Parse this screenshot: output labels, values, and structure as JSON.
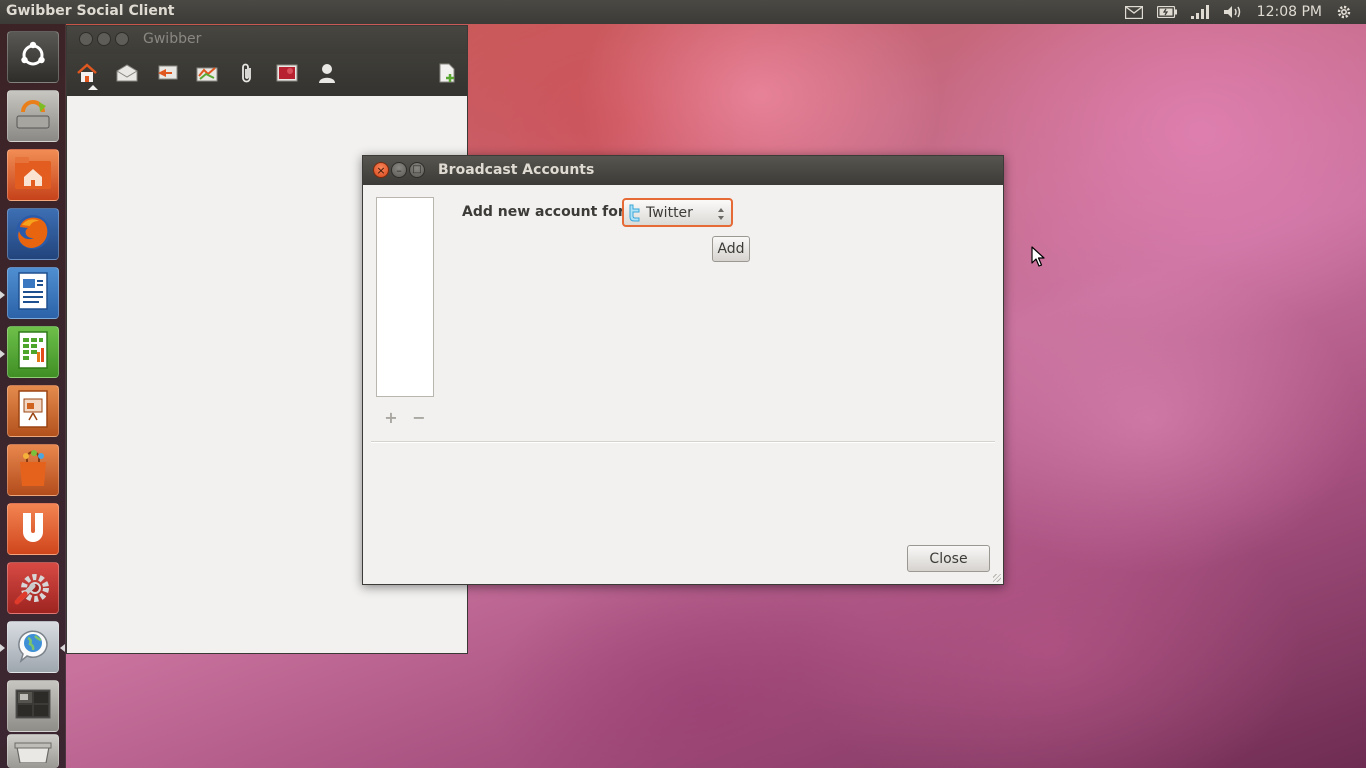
{
  "top_panel": {
    "app_title": "Gwibber Social Client",
    "clock": "12:08 PM",
    "indicators": [
      "mail-icon",
      "battery-icon",
      "network-signal-icon",
      "volume-icon",
      "session-gear-icon"
    ]
  },
  "launcher": {
    "items": [
      {
        "name": "dash-home",
        "icon": "ubuntu-logo-icon"
      },
      {
        "name": "update-manager",
        "icon": "update-manager-icon"
      },
      {
        "name": "home-folder",
        "icon": "home-folder-icon"
      },
      {
        "name": "firefox",
        "icon": "firefox-icon"
      },
      {
        "name": "libreoffice-writer",
        "icon": "writer-icon"
      },
      {
        "name": "libreoffice-calc",
        "icon": "calc-icon"
      },
      {
        "name": "libreoffice-impress",
        "icon": "impress-icon"
      },
      {
        "name": "software-center",
        "icon": "shopping-bag-icon"
      },
      {
        "name": "ubuntu-one",
        "icon": "ubuntu-one-icon"
      },
      {
        "name": "system-settings",
        "icon": "settings-wrench-icon"
      },
      {
        "name": "gwibber",
        "icon": "gwibber-globe-icon"
      },
      {
        "name": "workspace-switcher",
        "icon": "workspace-switcher-icon"
      },
      {
        "name": "trash",
        "icon": "trash-icon"
      }
    ]
  },
  "gwibber_window": {
    "title": "Gwibber",
    "toolbar": [
      "home-icon",
      "messages-icon",
      "replies-icon",
      "private-icon",
      "attachments-icon",
      "images-icon",
      "user-icon",
      "new-stream-icon"
    ]
  },
  "dialog": {
    "title": "Broadcast Accounts",
    "add_label": "Add new account for:",
    "account_type": "Twitter",
    "add_button": "Add",
    "close_button": "Close",
    "list_add": "+",
    "list_remove": "−",
    "title_buttons": {
      "close": "×",
      "minimize": "–",
      "maximize": "□"
    }
  },
  "colors": {
    "panel": "#3c3b37",
    "dialog_bg": "#f2f1f0",
    "focus_ring": "#e56a35",
    "close_button": "#e0571f",
    "twitter_blue": "#4fc3f0"
  }
}
